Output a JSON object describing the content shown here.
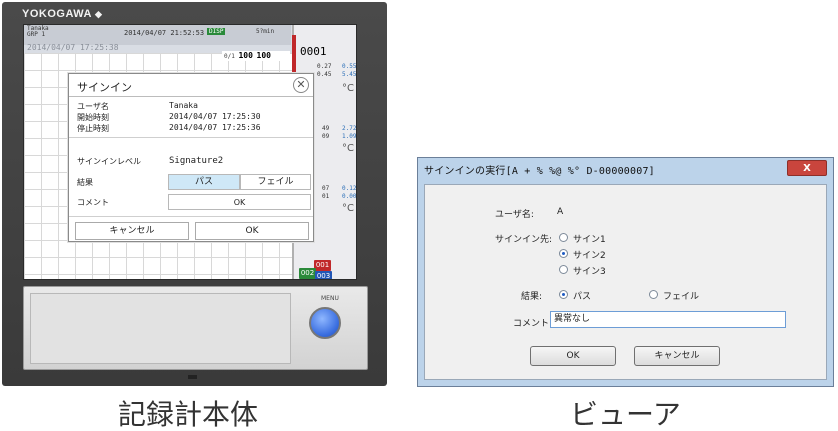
{
  "recorder": {
    "brand": "YOKOGAWA",
    "brand_mark": "◆",
    "screen": {
      "user_short": "Tanaka",
      "group_short": "GRP 1",
      "datetime": "2014/04/07 21:52:53",
      "disp": "DISP",
      "interval": "5?min",
      "trend_date": "2014/04/07 17:25:38",
      "scale_left": "0/1",
      "scale_a": "100",
      "scale_b": "100",
      "channel_big": "0001",
      "side_values": [
        {
          "a": "0.27",
          "b": "0.55"
        },
        {
          "a": "0.45",
          "b": "5.45"
        },
        {
          "a": "49",
          "b": "2.72"
        },
        {
          "a": "09",
          "b": "1.09"
        },
        {
          "a": "07",
          "b": "0.12"
        },
        {
          "a": "01",
          "b": "0.00"
        }
      ],
      "unit": "°C",
      "tags": [
        "001",
        "002",
        "003"
      ]
    },
    "dialog": {
      "title": "サインイン",
      "close": "✕",
      "user_label": "ユーザ名",
      "user_value": "Tanaka",
      "start_label": "開始時刻",
      "start_value": "2014/04/07 17:25:30",
      "stop_label": "停止時刻",
      "stop_value": "2014/04/07 17:25:36",
      "level_label": "サインインレベル",
      "level_value": "Signature2",
      "result_label": "結果",
      "result_pass": "パス",
      "result_fail": "フェイル",
      "comment_label": "コメント",
      "comment_value": "OK",
      "cancel_btn": "キャンセル",
      "ok_btn": "OK"
    },
    "menu_label": "MENU"
  },
  "viewer": {
    "title": "サインインの実行[A    +    %    %@    %°         D-00000007]",
    "close": "X",
    "user_label": "ユーザ名:",
    "user_value": "A",
    "signin_to_label": "サインイン先:",
    "sign_options": [
      "サイン1",
      "サイン2",
      "サイン3"
    ],
    "sign_selected": "サイン2",
    "result_label": "結果:",
    "result_pass": "パス",
    "result_fail": "フェイル",
    "result_selected": "パス",
    "comment_label": "コメント:",
    "comment_value": "異常なし",
    "ok_btn": "OK",
    "cancel_btn": "キャンセル"
  },
  "captions": {
    "left": "記録計本体",
    "right": "ビューア"
  },
  "colors": {
    "selected_segment": "#cfe8f7",
    "title_close_red": "#c9453d",
    "radio_selected": "#1f5bc2",
    "menu_button_blue": "#3a6ee0"
  }
}
